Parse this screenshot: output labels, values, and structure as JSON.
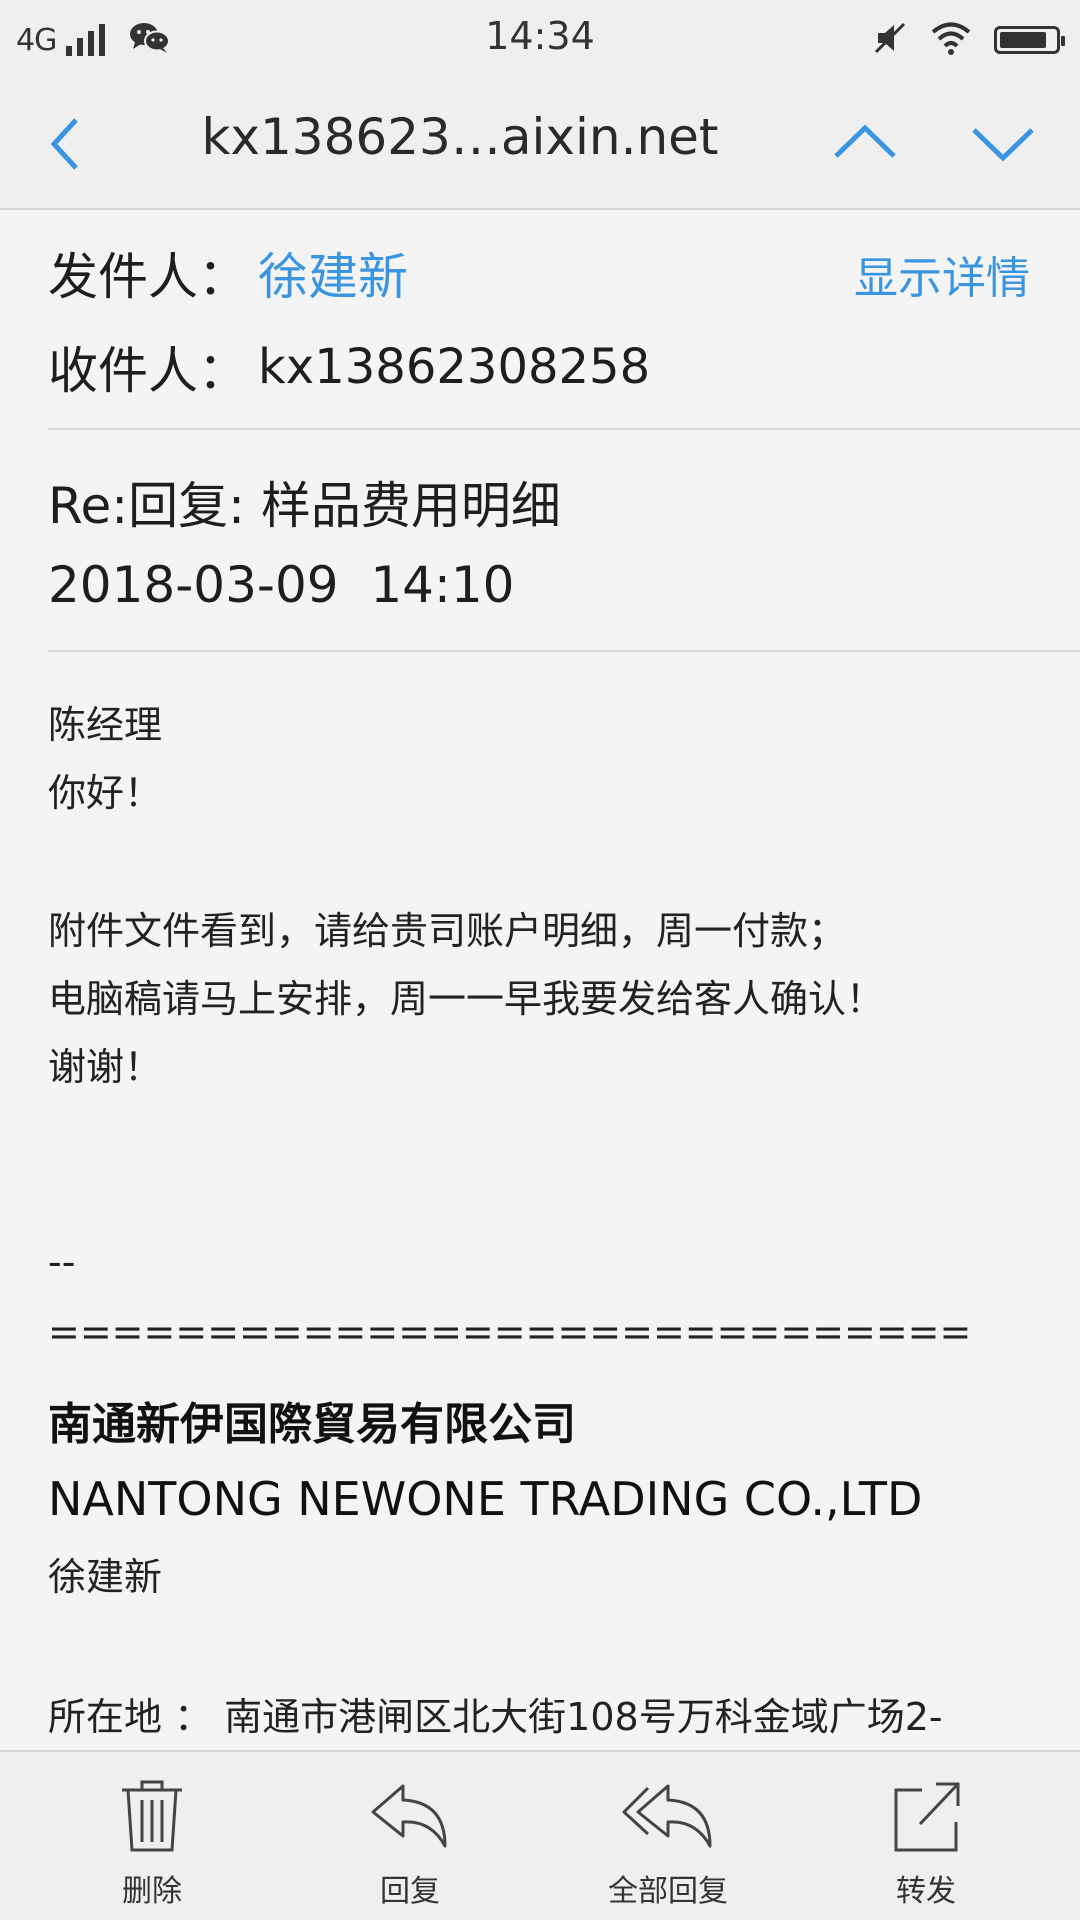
{
  "status_bar": {
    "network": "4G",
    "time": "14:34",
    "battery_level": 0.85,
    "icons": [
      "signal-icon",
      "wechat-icon",
      "mute-icon",
      "wifi-icon",
      "battery-icon"
    ]
  },
  "nav": {
    "title": "kx138623…aixin.net",
    "icons": [
      "back-icon",
      "previous-mail-icon",
      "next-mail-icon"
    ]
  },
  "header": {
    "sender_label": "发件人：",
    "sender_name": "徐建新",
    "details_link": "显示详情",
    "recipient_label": "收件人：",
    "recipient_value": "kx13862308258"
  },
  "mail": {
    "subject": "Re:回复: 样品费用明细",
    "datetime": "2018-03-09  14:10"
  },
  "body": {
    "line1": "陈经理",
    "line2": "你好！",
    "line3": "附件文件看到，请给贵司账户明细，周一付款；",
    "line4": "电脑稿请马上安排，周一一早我要发给客人确认！",
    "line5": "谢谢！",
    "sig_dash": "--",
    "sig_rule": "=============================",
    "company_cn": "南通新伊国際貿易有限公司",
    "company_en": "NANTONG NEWONE TRADING CO.,LTD",
    "sig_name": "徐建新",
    "address": "所在地 ： 南通市港闸区北大街108号万科金域广场2-"
  },
  "toolbar": {
    "delete": "删除",
    "reply": "回复",
    "reply_all": "全部回复",
    "forward": "转发"
  },
  "colors": {
    "accent": "#3a95e0",
    "background": "#f4f4f5",
    "bar": "#efeff0"
  }
}
